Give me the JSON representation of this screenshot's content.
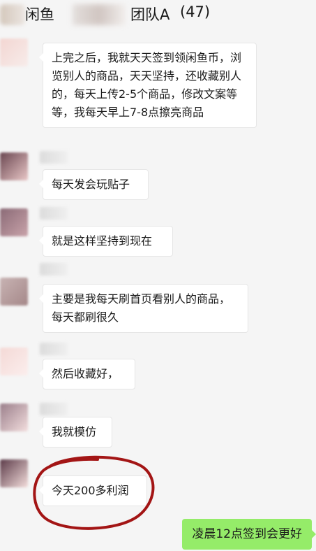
{
  "header": {
    "title_part1": "闲鱼",
    "title_part2": "团队A",
    "member_count": "(47)"
  },
  "messages": [
    {
      "text": "上完之后，我就天天签到领闲鱼币，浏览别人的商品，天天坚持，还收藏别人的，每天上传2-5个商品，修改文案等等，我每天早上7-8点擦亮商品"
    },
    {
      "text": "每天发会玩贴子"
    },
    {
      "text": "就是这样坚持到现在"
    },
    {
      "text": "主要是我每天刷首页看别人的商品，每天都刷很久"
    },
    {
      "text": "然后收藏好，"
    },
    {
      "text": "我就模仿"
    },
    {
      "text": "今天200多利润"
    }
  ],
  "self_message": {
    "text": "凌晨12点签到会更好"
  },
  "colors": {
    "background": "#f5f5f5",
    "incoming_bubble": "#ffffff",
    "outgoing_bubble": "#95ec69",
    "annotation_circle": "#a31515"
  }
}
